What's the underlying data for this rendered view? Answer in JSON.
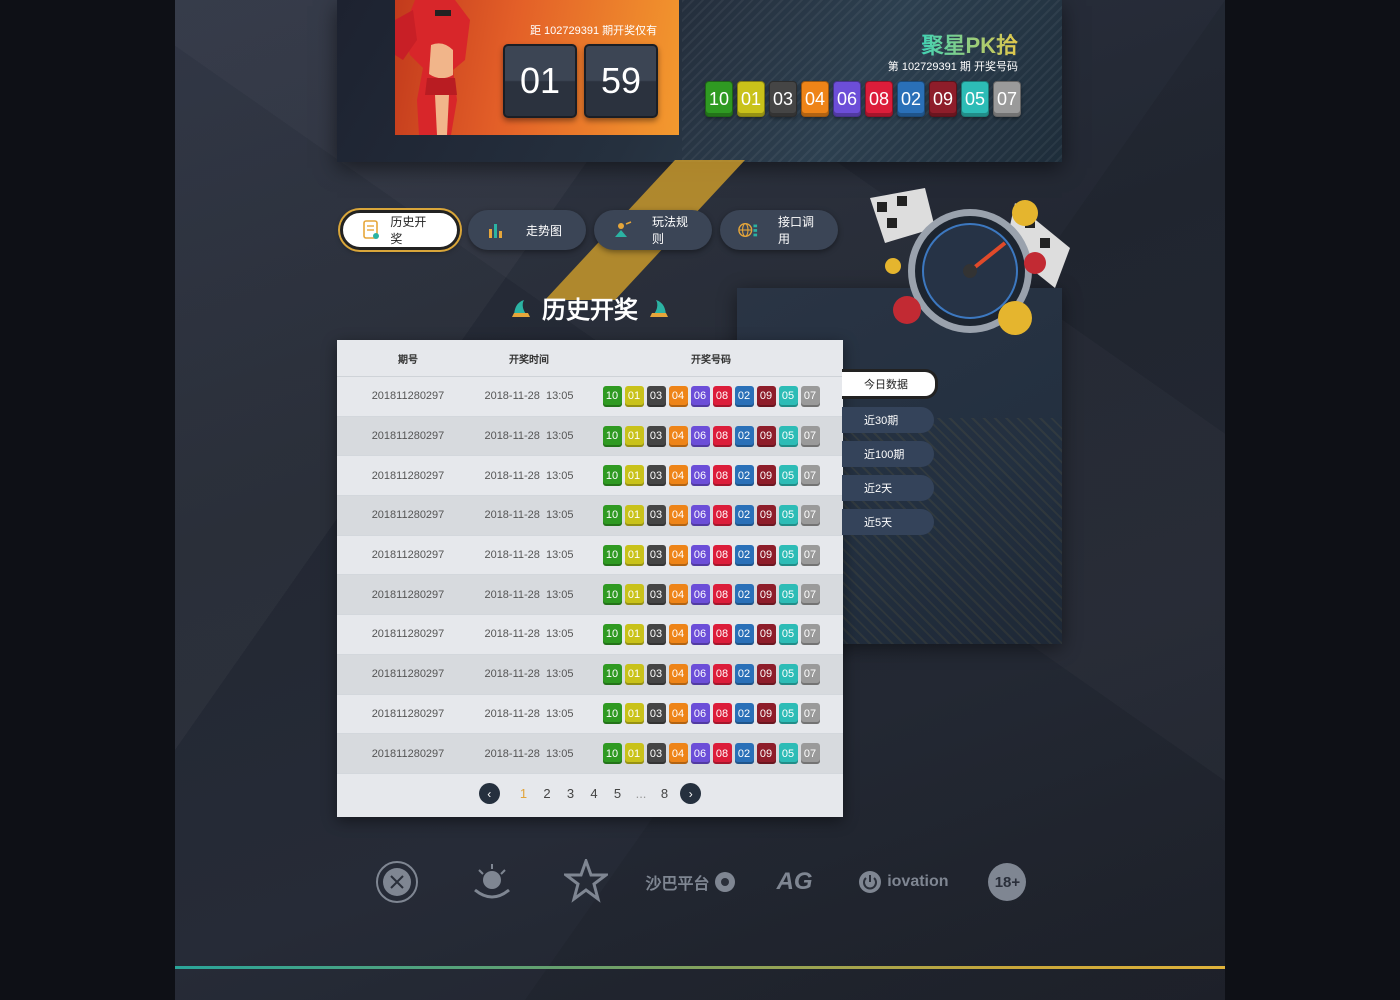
{
  "banner": {
    "countdown_caption": "距 102729391 期开奖仅有",
    "minutes": "01",
    "seconds": "59",
    "game_title": "聚星PK拾",
    "draw_caption": "第 102729391 期 开奖号码",
    "numbers": [
      "10",
      "01",
      "03",
      "04",
      "06",
      "08",
      "02",
      "09",
      "05",
      "07"
    ]
  },
  "ball_colors": {
    "01": "#c9c21a",
    "02": "#2a70b8",
    "03": "#454545",
    "04": "#ee8418",
    "05": "#2dbcb6",
    "06": "#6c4ed8",
    "07": "#9a9a9a",
    "08": "#dc1d3a",
    "09": "#8e1d2a",
    "10": "#2f9a22"
  },
  "tabs": [
    {
      "label": "历史开奖",
      "icon": "document-icon"
    },
    {
      "label": "走势图",
      "icon": "bar-chart-icon"
    },
    {
      "label": "玩法规则",
      "icon": "rules-icon"
    },
    {
      "label": "接口调用",
      "icon": "globe-icon"
    }
  ],
  "section_title": "历史开奖",
  "table": {
    "headers": [
      "期号",
      "开奖时间",
      "开奖号码"
    ],
    "rows": [
      {
        "issue": "201811280297",
        "time": "2018-11-28  13:05",
        "nums": [
          "10",
          "01",
          "03",
          "04",
          "06",
          "08",
          "02",
          "09",
          "05",
          "07"
        ]
      },
      {
        "issue": "201811280297",
        "time": "2018-11-28  13:05",
        "nums": [
          "10",
          "01",
          "03",
          "04",
          "06",
          "08",
          "02",
          "09",
          "05",
          "07"
        ]
      },
      {
        "issue": "201811280297",
        "time": "2018-11-28  13:05",
        "nums": [
          "10",
          "01",
          "03",
          "04",
          "06",
          "08",
          "02",
          "09",
          "05",
          "07"
        ]
      },
      {
        "issue": "201811280297",
        "time": "2018-11-28  13:05",
        "nums": [
          "10",
          "01",
          "03",
          "04",
          "06",
          "08",
          "02",
          "09",
          "05",
          "07"
        ]
      },
      {
        "issue": "201811280297",
        "time": "2018-11-28  13:05",
        "nums": [
          "10",
          "01",
          "03",
          "04",
          "06",
          "08",
          "02",
          "09",
          "05",
          "07"
        ]
      },
      {
        "issue": "201811280297",
        "time": "2018-11-28  13:05",
        "nums": [
          "10",
          "01",
          "03",
          "04",
          "06",
          "08",
          "02",
          "09",
          "05",
          "07"
        ]
      },
      {
        "issue": "201811280297",
        "time": "2018-11-28  13:05",
        "nums": [
          "10",
          "01",
          "03",
          "04",
          "06",
          "08",
          "02",
          "09",
          "05",
          "07"
        ]
      },
      {
        "issue": "201811280297",
        "time": "2018-11-28  13:05",
        "nums": [
          "10",
          "01",
          "03",
          "04",
          "06",
          "08",
          "02",
          "09",
          "05",
          "07"
        ]
      },
      {
        "issue": "201811280297",
        "time": "2018-11-28  13:05",
        "nums": [
          "10",
          "01",
          "03",
          "04",
          "06",
          "08",
          "02",
          "09",
          "05",
          "07"
        ]
      },
      {
        "issue": "201811280297",
        "time": "2018-11-28  13:05",
        "nums": [
          "10",
          "01",
          "03",
          "04",
          "06",
          "08",
          "02",
          "09",
          "05",
          "07"
        ]
      }
    ]
  },
  "pager": {
    "pages": [
      "1",
      "2",
      "3",
      "4",
      "5"
    ],
    "ellipsis": "...",
    "last": "8",
    "current": "1"
  },
  "side_buttons": [
    "今日数据",
    "近30期",
    "近100期",
    "近2天",
    "近5天"
  ],
  "footer_logos": [
    "badge-logo",
    "pagcor-logo",
    "star-logo",
    "沙巴平台",
    "AG",
    "iovation",
    "18+"
  ]
}
